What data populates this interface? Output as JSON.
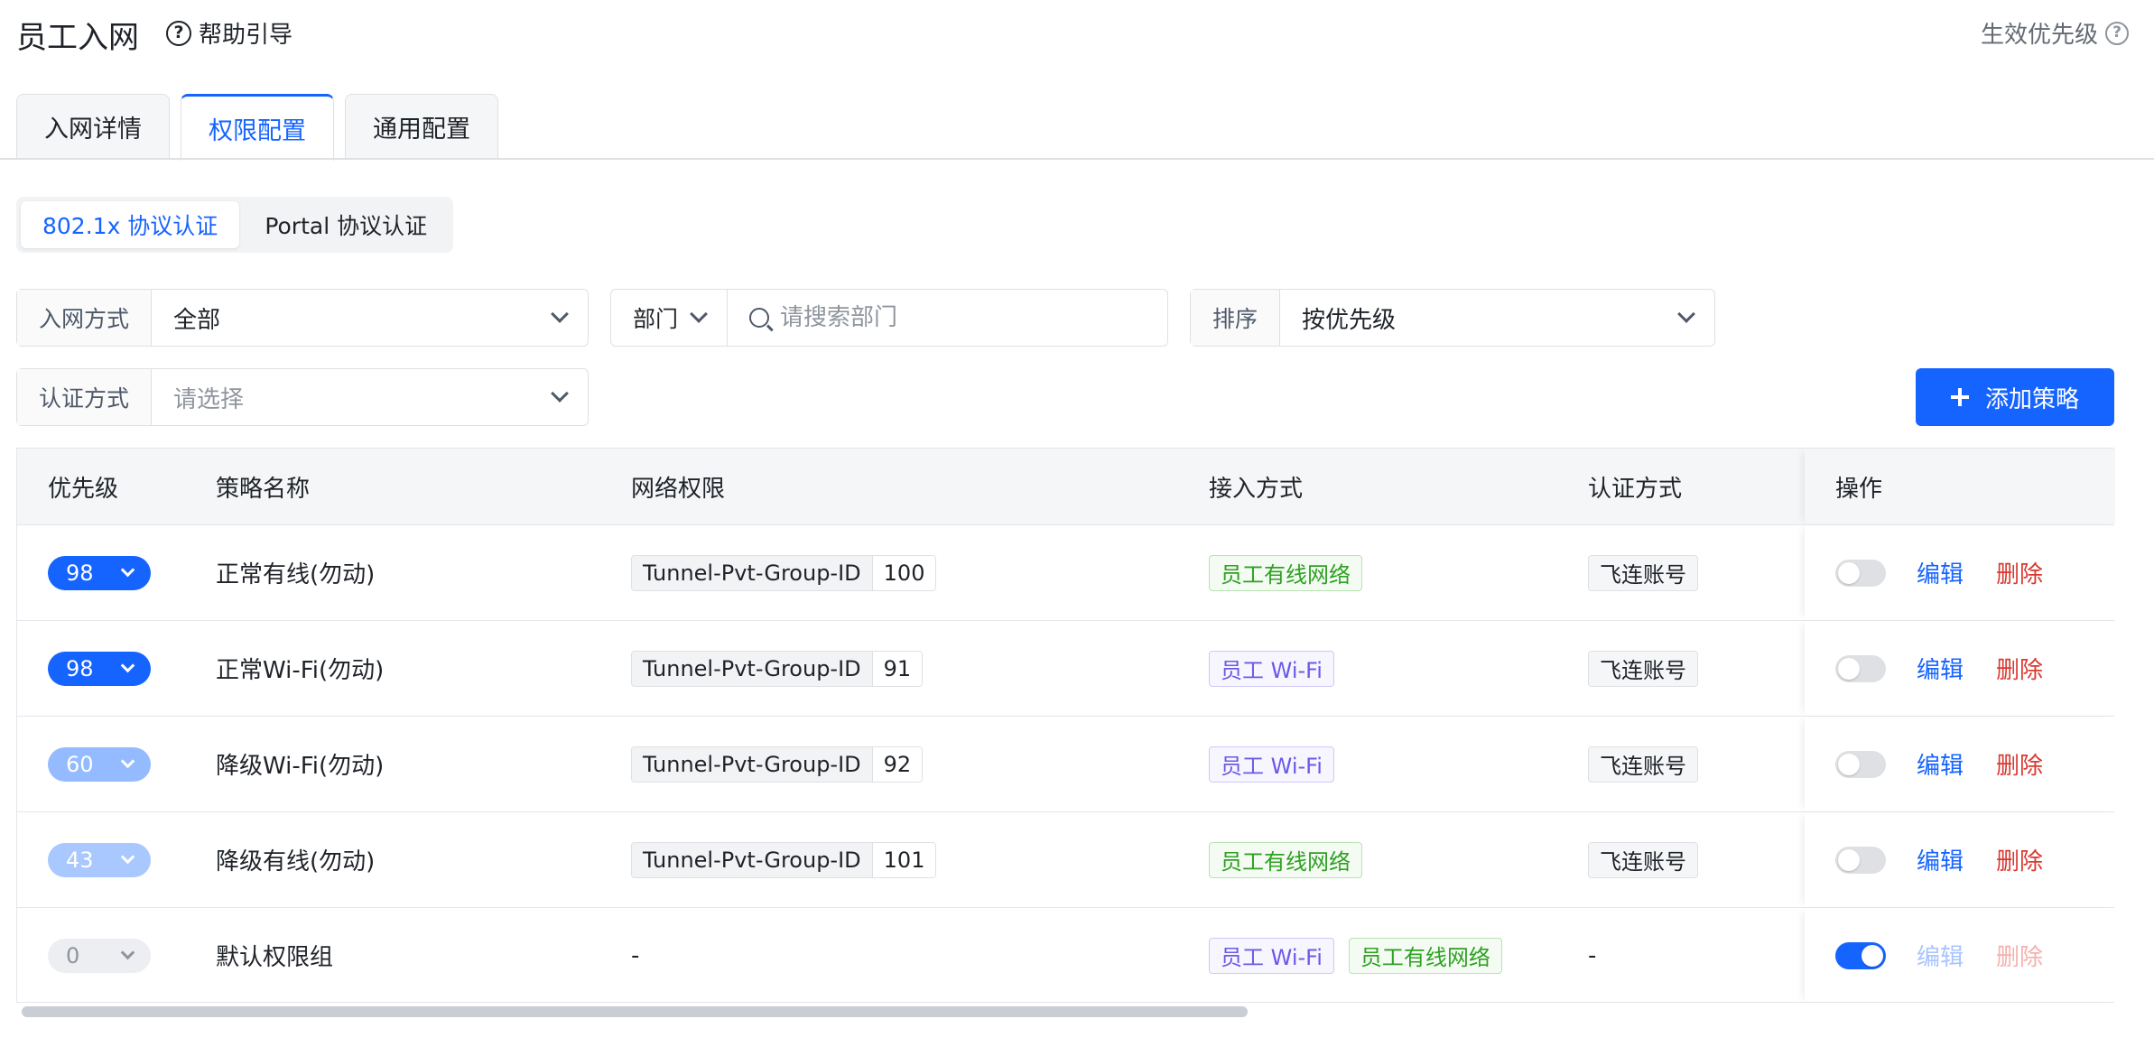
{
  "header": {
    "title": "员工入网",
    "help_label": "帮助引导",
    "priority_effect_label": "生效优先级"
  },
  "tabs": [
    {
      "label": "入网详情",
      "active": false
    },
    {
      "label": "权限配置",
      "active": true
    },
    {
      "label": "通用配置",
      "active": false
    }
  ],
  "protocol_segments": [
    {
      "label": "802.1x 协议认证",
      "active": true
    },
    {
      "label": "Portal 协议认证",
      "active": false
    }
  ],
  "filters": {
    "access_mode": {
      "label": "入网方式",
      "value": "全部"
    },
    "department": {
      "label": "部门",
      "placeholder": "请搜索部门"
    },
    "sort": {
      "label": "排序",
      "value": "按优先级"
    },
    "auth_method": {
      "label": "认证方式",
      "placeholder": "请选择"
    }
  },
  "add_button_label": "添加策略",
  "table": {
    "columns": [
      "优先级",
      "策略名称",
      "网络权限",
      "接入方式",
      "认证方式",
      "操作"
    ],
    "rows": [
      {
        "priority": "98",
        "name": "正常有线(勿动)",
        "perm_key": "Tunnel-Pvt-Group-ID",
        "perm_value": "100",
        "access": [
          {
            "label": "员工有线网络",
            "color": "green"
          }
        ],
        "auth": "飞连账号",
        "enabled": false,
        "edit": "编辑",
        "delete": "删除"
      },
      {
        "priority": "98",
        "name": "正常Wi-Fi(勿动)",
        "perm_key": "Tunnel-Pvt-Group-ID",
        "perm_value": "91",
        "access": [
          {
            "label": "员工 Wi-Fi",
            "color": "purple"
          }
        ],
        "auth": "飞连账号",
        "enabled": false,
        "edit": "编辑",
        "delete": "删除"
      },
      {
        "priority": "60",
        "name": "降级Wi-Fi(勿动)",
        "perm_key": "Tunnel-Pvt-Group-ID",
        "perm_value": "92",
        "access": [
          {
            "label": "员工 Wi-Fi",
            "color": "purple"
          }
        ],
        "auth": "飞连账号",
        "enabled": false,
        "edit": "编辑",
        "delete": "删除"
      },
      {
        "priority": "43",
        "name": "降级有线(勿动)",
        "perm_key": "Tunnel-Pvt-Group-ID",
        "perm_value": "101",
        "access": [
          {
            "label": "员工有线网络",
            "color": "green"
          }
        ],
        "auth": "飞连账号",
        "enabled": false,
        "edit": "编辑",
        "delete": "删除"
      },
      {
        "priority": "0",
        "name": "默认权限组",
        "perm_text": "-",
        "access": [
          {
            "label": "员工 Wi-Fi",
            "color": "purple"
          },
          {
            "label": "员工有线网络",
            "color": "green"
          }
        ],
        "auth_text": "-",
        "enabled": true,
        "edit": "编辑",
        "delete": "删除",
        "default": true
      }
    ]
  },
  "colors": {
    "primary": "#1664ff",
    "priority_high": "#1664ff",
    "priority_mid": "#94bbff",
    "priority_low": "#a8c8ff",
    "danger": "#d83931",
    "tag_green": "#2ea121",
    "tag_purple": "#6a5ae6"
  },
  "icons": {
    "help": "question-circle-icon",
    "search": "search-icon",
    "dropdown": "chevron-down-icon",
    "add": "plus-icon"
  }
}
